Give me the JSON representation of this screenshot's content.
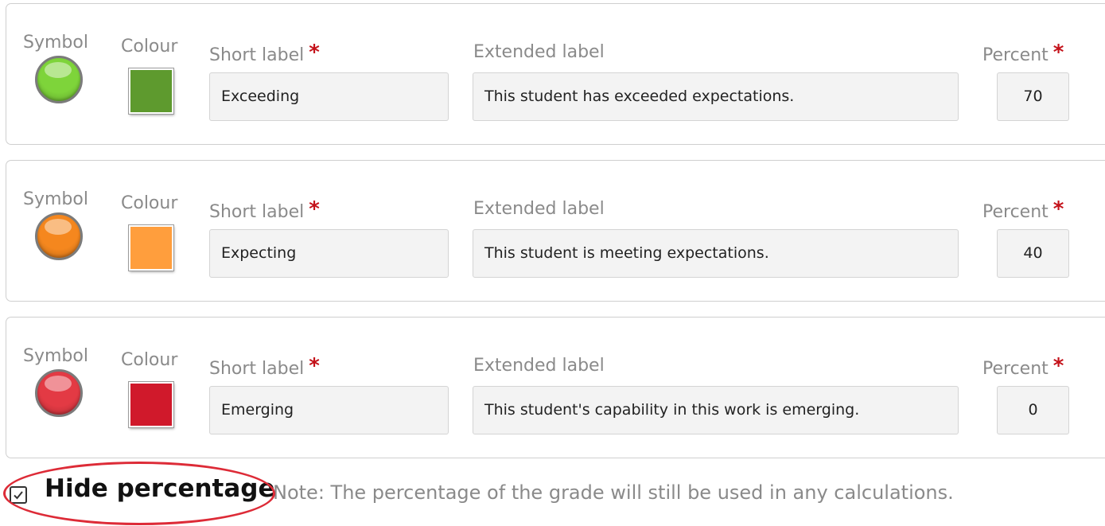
{
  "labels": {
    "symbol": "Symbol",
    "colour": "Colour",
    "short_label": "Short label",
    "extended_label": "Extended label",
    "percent": "Percent",
    "required_mark": "*"
  },
  "grades": [
    {
      "symbol_name": "green-circle-icon",
      "symbol_color": "#7ed43a",
      "colour": "#5e9a2e",
      "short_label": "Exceeding",
      "extended_label": "This student has exceeded expectations.",
      "percent": "70"
    },
    {
      "symbol_name": "orange-circle-icon",
      "symbol_color": "#f5871e",
      "colour": "#ff9e3d",
      "short_label": "Expecting",
      "extended_label": "This student is meeting expectations.",
      "percent": "40"
    },
    {
      "symbol_name": "red-circle-icon",
      "symbol_color": "#e33a44",
      "colour": "#d0192b",
      "short_label": "Emerging",
      "extended_label": "This student's capability in this work is emerging.",
      "percent": "0"
    }
  ],
  "footer": {
    "hide_percentage_label": "Hide percentage",
    "hide_percentage_checked": true,
    "note": "Note: The percentage of the grade will still be used in any calculations."
  },
  "colors": {
    "required": "#c4121a",
    "highlight": "#dd2b37"
  }
}
